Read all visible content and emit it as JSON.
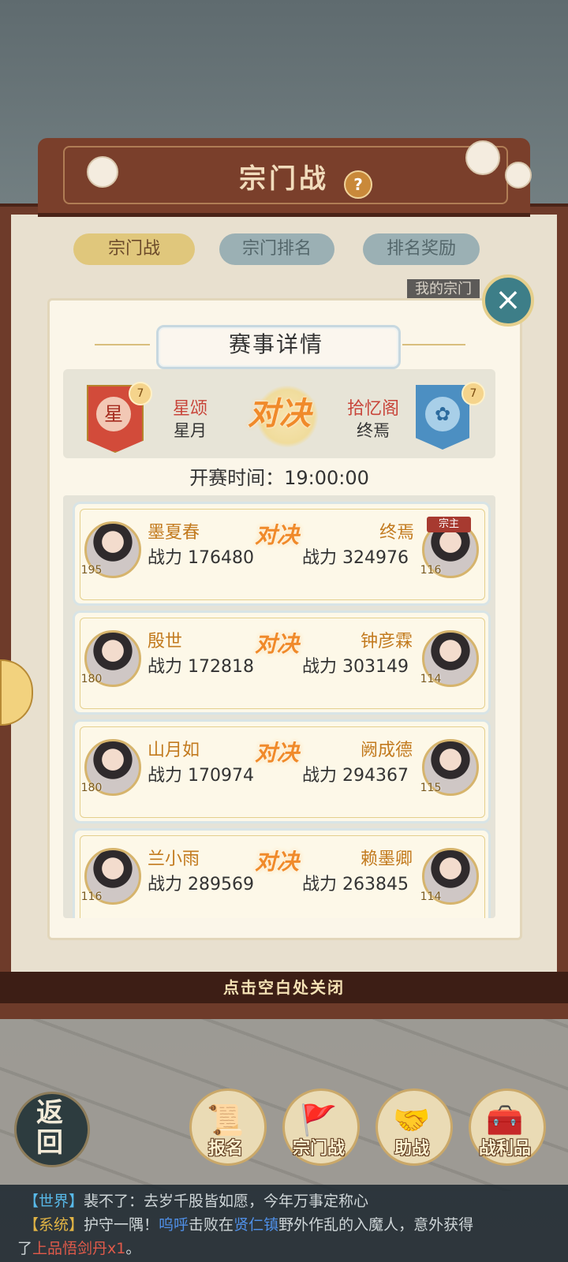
{
  "header": {
    "title": "宗门战",
    "help": "?"
  },
  "tabs": [
    {
      "label": "宗门战",
      "active": true
    },
    {
      "label": "宗门排名",
      "active": false
    },
    {
      "label": "排名奖励",
      "active": false
    }
  ],
  "my_sect_tab": "我的宗门",
  "modal": {
    "title": "赛事详情",
    "close_icon": "×",
    "versus": {
      "left": {
        "emblem": "星",
        "level": "7",
        "name": "星颂",
        "leader": "星月"
      },
      "right": {
        "emblem": "✿",
        "level": "7",
        "name": "拾忆阁",
        "leader": "终焉"
      },
      "vs_text": "对决"
    },
    "start_time": "开赛时间：19:00:00",
    "matches": [
      {
        "left_name": "墨夏春",
        "left_power": "战力 176480",
        "left_level": "195",
        "right_name": "终焉",
        "right_power": "战力 324976",
        "right_level": "116",
        "right_badge": "宗主"
      },
      {
        "left_name": "殷世",
        "left_power": "战力 172818",
        "left_level": "180",
        "right_name": "钟彦霖",
        "right_power": "战力 303149",
        "right_level": "114"
      },
      {
        "left_name": "山月如",
        "left_power": "战力 170974",
        "left_level": "180",
        "right_name": "阙成德",
        "right_power": "战力 294367",
        "right_level": "115"
      },
      {
        "left_name": "兰小雨",
        "left_power": "战力 289569",
        "left_level": "116",
        "right_name": "赖墨卿",
        "right_power": "战力 263845",
        "right_level": "114"
      }
    ],
    "match_vs": "对决"
  },
  "close_hint": "点击空白处关闭",
  "nav": {
    "back": "返回",
    "items": [
      {
        "label": "报名",
        "icon": "scroll-brush-icon"
      },
      {
        "label": "宗门战",
        "icon": "flag-mountain-icon"
      },
      {
        "label": "助战",
        "icon": "handshake-icon"
      },
      {
        "label": "战利品",
        "icon": "treasure-chest-icon"
      }
    ]
  },
  "chat": {
    "line1": {
      "tag": "【世界】",
      "text": "裴不了：去岁千股皆如愿，今年万事定称心"
    },
    "line2": {
      "tag": "【系统】",
      "t1": "护守一隅！",
      "n1": "呜呼",
      "t2": "击败在",
      "n2": "贤仁镇",
      "t3": "野外作乱的入魔人，意外获得"
    },
    "line3": {
      "t1": "了",
      "item": "上品悟剑丹x1",
      "t2": "。"
    }
  },
  "colors": {
    "frame": "#6e3b2a",
    "accent_orange": "#f08a2a",
    "teal": "#3d7e88",
    "name_red": "#c8453a"
  }
}
